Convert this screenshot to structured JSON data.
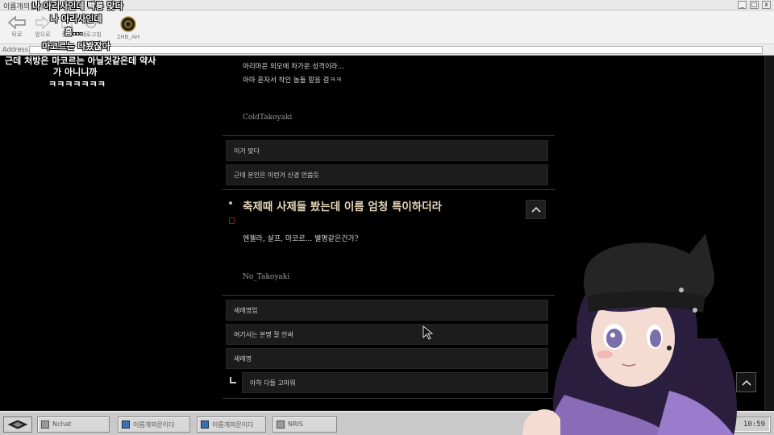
{
  "window": {
    "title": "이름개의문이다",
    "controls": [
      "_",
      "□",
      "x"
    ]
  },
  "toolbar": {
    "buttons": [
      {
        "label": "뒤로",
        "icon": "back-arrow-icon"
      },
      {
        "label": "앞으로",
        "icon": "forward-arrow-icon"
      },
      {
        "label": "중지",
        "icon": "stop-icon"
      },
      {
        "label": "새로고침",
        "icon": "refresh-icon"
      },
      {
        "label": "홈",
        "icon": "home-icon"
      }
    ],
    "emblem_label": "2HB_AH"
  },
  "address": {
    "label": "Address",
    "value": ""
  },
  "chat": [
    {
      "text": "나 아리사인데 빡룡 맞다"
    },
    {
      "text": "나 아리사인데"
    },
    {
      "text": "흠..."
    },
    {
      "text": "마코르는 다봤잖아"
    },
    {
      "text": "근데 처방은 마코르는 아닐것같은데 약사"
    },
    {
      "text": "가 아니니까"
    },
    {
      "text": "ㅋㅋㅋㅋㅋㅋㅋ"
    }
  ],
  "post1": {
    "body_lines": [
      "아리마은 외모에 차가운 성격이라...",
      "아마 혼자서 착인 놈들 말을 걸ㅋㅋ"
    ],
    "author": "ColdTakoyaki",
    "replies": [
      "이거 맞다",
      "근데 본인은 이런거 신경 안씀듯"
    ]
  },
  "post2": {
    "title": "축제때 사제들 봤는데 이름 엄청 특이하더라",
    "body": "엔젤라, 샬프, 마코르... 별명같은건가?",
    "author": "No_Takoyaki",
    "replies": [
      "세례명임",
      "여기서는 본명 잘 안써",
      "세례명"
    ],
    "sub_reply": "아하 다들 고마워"
  },
  "taskbar": {
    "tasks": [
      {
        "label": "Nchat",
        "icon": "gray"
      },
      {
        "label": "이름개의문이다",
        "icon": "blue"
      },
      {
        "label": "이름개의문이다",
        "icon": "blue"
      },
      {
        "label": "NRIS",
        "icon": "gray"
      }
    ],
    "clock": "10:59"
  },
  "colors": {
    "background": "#000000",
    "title_gold": "#e8d8b8",
    "reply_bg": "#1c1c1c",
    "taskbar": "#c9c9c9"
  }
}
